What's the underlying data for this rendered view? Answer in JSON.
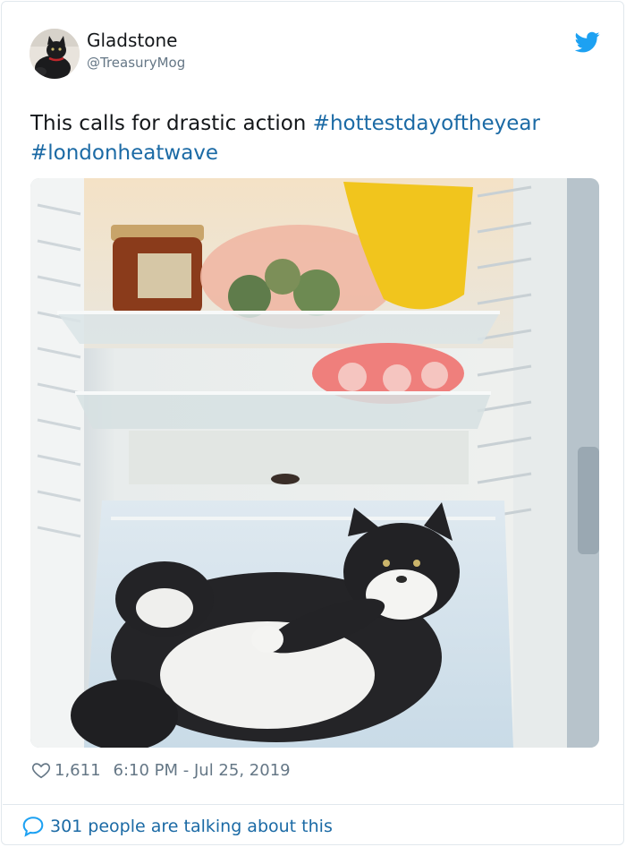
{
  "user": {
    "display_name": "Gladstone",
    "handle": "@TreasuryMog",
    "avatar_icon": "cat-avatar"
  },
  "tweet": {
    "text": "This calls for drastic action ",
    "hashtags": [
      "#hottestdayoftheyear",
      "#londonheatwave"
    ]
  },
  "media": {
    "description_icon": "cat-in-fridge-photo"
  },
  "footer": {
    "likes": "1,611",
    "timestamp": "6:10 PM - Jul 25, 2019",
    "conversation": "301 people are talking about this"
  },
  "colors": {
    "twitter_blue": "#1da1f2",
    "link_blue": "#1b6aa5",
    "secondary_text": "#657786",
    "border": "#e1e8ed"
  }
}
